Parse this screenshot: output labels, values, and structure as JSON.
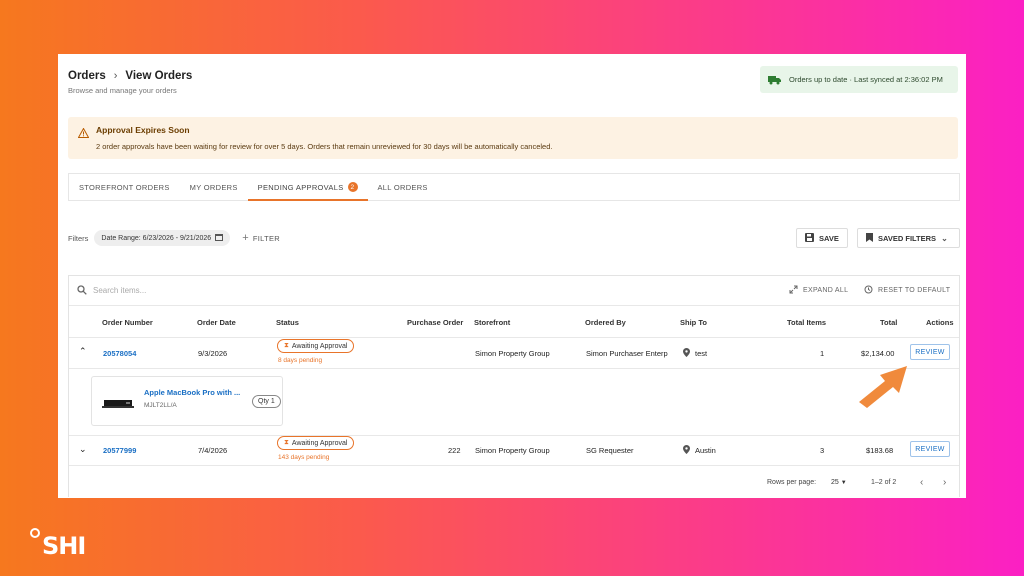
{
  "header": {
    "breadcrumb_root": "Orders",
    "breadcrumb_sep": "›",
    "breadcrumb_current": "View Orders",
    "subtitle": "Browse and manage your orders",
    "sync_text": "Orders up to date · Last synced at 2:36:02 PM"
  },
  "alert": {
    "title": "Approval Expires Soon",
    "message": "2 order approvals have been waiting for review for over 5 days. Orders that remain unreviewed for 30 days will be automatically canceled."
  },
  "tabs": [
    {
      "label": "STOREFRONT ORDERS"
    },
    {
      "label": "MY ORDERS"
    },
    {
      "label": "PENDING APPROVALS",
      "badge": "2"
    },
    {
      "label": "ALL ORDERS"
    }
  ],
  "filters": {
    "label": "Filters",
    "chip": "Date Range: 6/23/2026 - 9/21/2026",
    "add_filter": "FILTER",
    "save": "SAVE",
    "saved_filters": "SAVED FILTERS"
  },
  "table": {
    "search_placeholder": "Search items...",
    "expand_all": "EXPAND ALL",
    "reset": "RESET TO DEFAULT",
    "columns": [
      "Order Number",
      "Order Date",
      "Status",
      "Purchase Order",
      "Storefront",
      "Ordered By",
      "Ship To",
      "Total Items",
      "Total",
      "Actions"
    ],
    "rows": [
      {
        "order_number": "20578054",
        "order_date": "9/3/2026",
        "status": "Awaiting Approval",
        "pending": "8 days pending",
        "purchase_order": "",
        "storefront": "Simon Property Group",
        "ordered_by": "Simon Purchaser Enterp",
        "ship_to": "test",
        "total_items": "1",
        "total": "$2,134.00",
        "action": "REVIEW",
        "product_name": "Apple MacBook Pro with ...",
        "product_sku": "MJLT2LL/A",
        "product_qty": "Qty 1"
      },
      {
        "order_number": "20577999",
        "order_date": "7/4/2026",
        "status": "Awaiting Approval",
        "pending": "143 days pending",
        "purchase_order": "222",
        "storefront": "Simon Property Group",
        "ordered_by": "SG Requester",
        "ship_to": "Austin",
        "total_items": "3",
        "total": "$183.68",
        "action": "REVIEW"
      }
    ],
    "footer": {
      "rows_per_page_label": "Rows per page:",
      "rows_per_page": "25",
      "range": "1–2 of 2"
    }
  },
  "brand": {
    "logo_text": "SHI"
  },
  "colors": {
    "accent": "#e8742a",
    "link": "#1a6fc4",
    "success_bg": "#e8f5e9"
  }
}
